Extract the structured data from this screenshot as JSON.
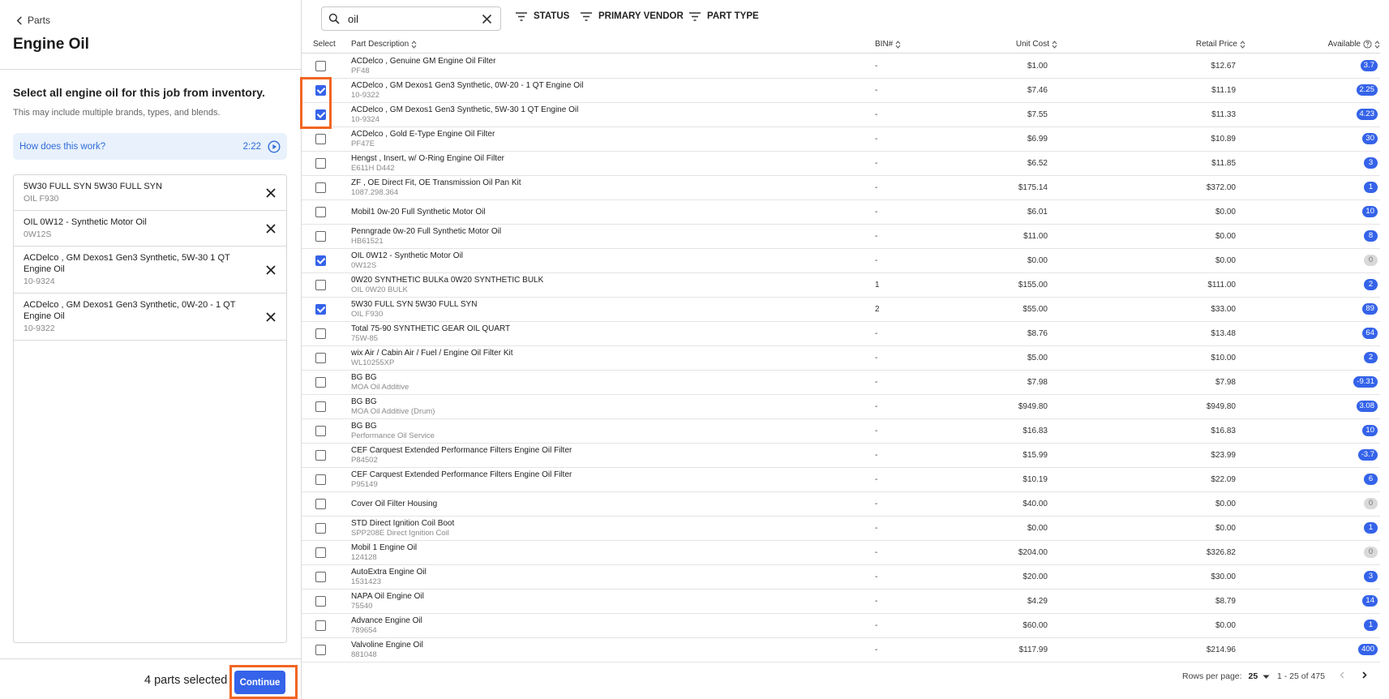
{
  "left": {
    "back_label": "Parts",
    "title": "Engine Oil",
    "instruction": "Select all engine oil for this job from inventory.",
    "subtext": "This may include multiple brands, types, and blends.",
    "howto_label": "How does this work?",
    "howto_duration": "2:22",
    "selected": [
      {
        "name": "5W30 FULL SYN 5W30 FULL SYN",
        "code": "OIL F930"
      },
      {
        "name": "OIL 0W12 - Synthetic Motor Oil",
        "code": "0W12S"
      },
      {
        "name": "ACDelco , GM Dexos1 Gen3 Synthetic, 5W-30 1 QT Engine Oil",
        "code": "10-9324"
      },
      {
        "name": "ACDelco , GM Dexos1 Gen3 Synthetic, 0W-20 - 1 QT Engine Oil",
        "code": "10-9322"
      }
    ],
    "count_label": "4 parts selected",
    "continue_label": "Continue"
  },
  "toolbar": {
    "search_value": "oil",
    "filters": [
      "STATUS",
      "PRIMARY VENDOR",
      "PART TYPE"
    ]
  },
  "table": {
    "headers": {
      "select": "Select",
      "description": "Part Description",
      "bin": "BIN#",
      "unit_cost": "Unit Cost",
      "retail_price": "Retail Price",
      "available": "Available"
    },
    "rows": [
      {
        "checked": false,
        "desc": "ACDelco , Genuine GM Engine Oil Filter",
        "sub": "PF48",
        "bin": "-",
        "unit_cost": "$1.00",
        "retail": "$12.67",
        "avail": "3.7"
      },
      {
        "checked": true,
        "desc": "ACDelco , GM Dexos1 Gen3 Synthetic, 0W-20 - 1 QT Engine Oil",
        "sub": "10-9322",
        "bin": "-",
        "unit_cost": "$7.46",
        "retail": "$11.19",
        "avail": "2.25"
      },
      {
        "checked": true,
        "desc": "ACDelco , GM Dexos1 Gen3 Synthetic, 5W-30 1 QT Engine Oil",
        "sub": "10-9324",
        "bin": "-",
        "unit_cost": "$7.55",
        "retail": "$11.33",
        "avail": "4.23"
      },
      {
        "checked": false,
        "desc": "ACDelco , Gold E-Type Engine Oil Filter",
        "sub": "PF47E",
        "bin": "-",
        "unit_cost": "$6.99",
        "retail": "$10.89",
        "avail": "30"
      },
      {
        "checked": false,
        "desc": "Hengst , Insert, w/ O-Ring Engine Oil Filter",
        "sub": "E611H D442",
        "bin": "-",
        "unit_cost": "$6.52",
        "retail": "$11.85",
        "avail": "3"
      },
      {
        "checked": false,
        "desc": "ZF , OE Direct Fit, OE Transmission Oil Pan Kit",
        "sub": "1087.298.364",
        "bin": "-",
        "unit_cost": "$175.14",
        "retail": "$372.00",
        "avail": "1"
      },
      {
        "checked": false,
        "desc": "Mobil1 0w-20 Full Synthetic Motor Oil",
        "sub": "",
        "bin": "-",
        "unit_cost": "$6.01",
        "retail": "$0.00",
        "avail": "10"
      },
      {
        "checked": false,
        "desc": "Penngrade 0w-20 Full Synthetic Motor Oil",
        "sub": "HB61521",
        "bin": "-",
        "unit_cost": "$11.00",
        "retail": "$0.00",
        "avail": "8"
      },
      {
        "checked": true,
        "desc": "OIL 0W12 - Synthetic Motor Oil",
        "sub": "0W12S",
        "bin": "-",
        "unit_cost": "$0.00",
        "retail": "$0.00",
        "avail": "0"
      },
      {
        "checked": false,
        "desc": "0W20 SYNTHETIC BULKa 0W20 SYNTHETIC BULK",
        "sub": "OIL 0W20 BULK",
        "bin": "1",
        "unit_cost": "$155.00",
        "retail": "$111.00",
        "avail": "2"
      },
      {
        "checked": true,
        "desc": "5W30 FULL SYN 5W30 FULL SYN",
        "sub": "OIL F930",
        "bin": "2",
        "unit_cost": "$55.00",
        "retail": "$33.00",
        "avail": "89"
      },
      {
        "checked": false,
        "desc": "Total 75-90 SYNTHETIC GEAR OIL QUART",
        "sub": "75W-85",
        "bin": "-",
        "unit_cost": "$8.76",
        "retail": "$13.48",
        "avail": "64"
      },
      {
        "checked": false,
        "desc": "wix Air / Cabin Air / Fuel / Engine Oil Filter Kit",
        "sub": "WL10255XP",
        "bin": "-",
        "unit_cost": "$5.00",
        "retail": "$10.00",
        "avail": "2"
      },
      {
        "checked": false,
        "desc": "BG BG",
        "sub": "MOA Oil Additive",
        "bin": "-",
        "unit_cost": "$7.98",
        "retail": "$7.98",
        "avail": "-9.31"
      },
      {
        "checked": false,
        "desc": "BG BG",
        "sub": "MOA Oil Additive (Drum)",
        "bin": "-",
        "unit_cost": "$949.80",
        "retail": "$949.80",
        "avail": "3.08"
      },
      {
        "checked": false,
        "desc": "BG BG",
        "sub": "Performance Oil Service",
        "bin": "-",
        "unit_cost": "$16.83",
        "retail": "$16.83",
        "avail": "10"
      },
      {
        "checked": false,
        "desc": "CEF Carquest Extended Performance Filters Engine Oil Filter",
        "sub": "P84502",
        "bin": "-",
        "unit_cost": "$15.99",
        "retail": "$23.99",
        "avail": "-3.7"
      },
      {
        "checked": false,
        "desc": "CEF Carquest Extended Performance Filters Engine Oil Filter",
        "sub": "P95149",
        "bin": "-",
        "unit_cost": "$10.19",
        "retail": "$22.09",
        "avail": "6"
      },
      {
        "checked": false,
        "desc": "Cover Oil Filter Housing",
        "sub": "",
        "bin": "-",
        "unit_cost": "$40.00",
        "retail": "$0.00",
        "avail": "0"
      },
      {
        "checked": false,
        "desc": "STD Direct Ignition Coil Boot",
        "sub": "SPP208E Direct Ignition Coil",
        "bin": "-",
        "unit_cost": "$0.00",
        "retail": "$0.00",
        "avail": "1"
      },
      {
        "checked": false,
        "desc": "Mobil 1 Engine Oil",
        "sub": "124128",
        "bin": "-",
        "unit_cost": "$204.00",
        "retail": "$326.82",
        "avail": "0"
      },
      {
        "checked": false,
        "desc": "AutoExtra Engine Oil",
        "sub": "1531423",
        "bin": "-",
        "unit_cost": "$20.00",
        "retail": "$30.00",
        "avail": "3"
      },
      {
        "checked": false,
        "desc": "NAPA Oil Engine Oil",
        "sub": "75540",
        "bin": "-",
        "unit_cost": "$4.29",
        "retail": "$8.79",
        "avail": "14"
      },
      {
        "checked": false,
        "desc": "Advance Engine Oil",
        "sub": "789654",
        "bin": "-",
        "unit_cost": "$60.00",
        "retail": "$0.00",
        "avail": "1"
      },
      {
        "checked": false,
        "desc": "Valvoline Engine Oil",
        "sub": "881048",
        "bin": "-",
        "unit_cost": "$117.99",
        "retail": "$214.96",
        "avail": "400"
      }
    ]
  },
  "pager": {
    "rows_per_page_label": "Rows per page:",
    "rows_per_page": "25",
    "range": "1 - 25 of 475"
  },
  "colors": {
    "accent": "#3563e9",
    "highlight": "#f26522"
  }
}
